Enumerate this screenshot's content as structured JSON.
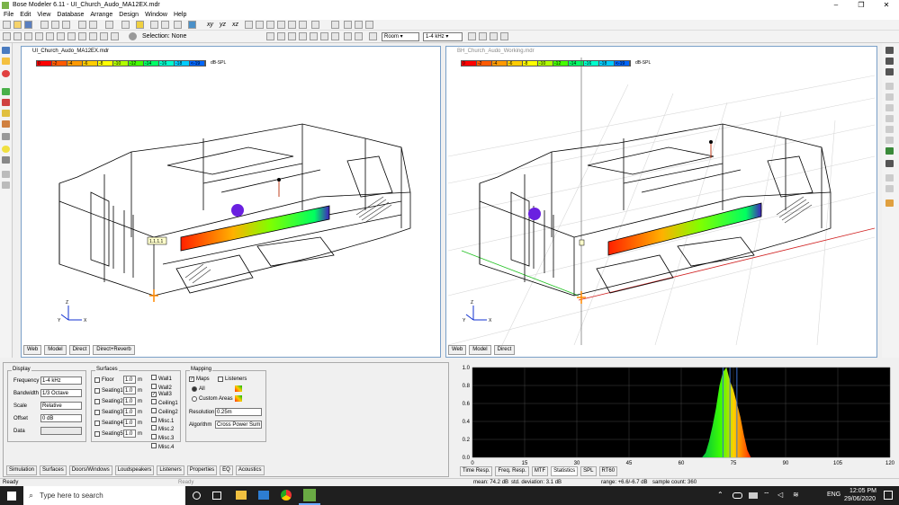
{
  "app": {
    "title": "Bose Modeler 6.11 - UI_Church_Audo_MA12EX.mdr"
  },
  "window_buttons": {
    "minimize": "–",
    "maximize": "❐",
    "close": "✕"
  },
  "menu": [
    "File",
    "Edit",
    "View",
    "Database",
    "Arrange",
    "Design",
    "Window",
    "Help"
  ],
  "toolbar": {
    "xy": "xy",
    "yz": "yz",
    "xz": "xz",
    "selection": "Selection: None",
    "room_select": "Room",
    "freq_select": "1-4 kHz"
  },
  "legend": {
    "labels": [
      "0",
      "-2",
      "-4",
      "-6",
      "-8",
      "-10",
      "-12",
      "-14",
      "-16",
      "-18",
      "<-19"
    ],
    "colors": [
      "#ff0000",
      "#ff5a00",
      "#ff9900",
      "#ffcc00",
      "#ffff00",
      "#b0ff00",
      "#44ff00",
      "#00ff66",
      "#00ffcc",
      "#00ccff",
      "#0066ff"
    ],
    "unit": "dB-SPL"
  },
  "windows": {
    "left": {
      "title": "UI_Church_Audo_MA12EX.mdr",
      "tabs": [
        "Web",
        "Model",
        "Direct",
        "Direct+Reverb"
      ],
      "listener_tag": "1.1.1.1"
    },
    "right": {
      "title": "BH_Church_Audo_Working.mdr",
      "tabs": [
        "Web",
        "Model",
        "Direct"
      ]
    }
  },
  "axes": {
    "y": "Y",
    "z": "Z",
    "x": "X"
  },
  "display": {
    "group": "Display",
    "frequency_label": "Frequency",
    "frequency": "1-4 kHz",
    "bandwidth_label": "Bandwidth",
    "bandwidth": "1/3 Octave",
    "scale_label": "Scale",
    "scale": "Relative",
    "offset_label": "Offset",
    "offset": "0 dB",
    "data_label": "Data",
    "data": ""
  },
  "surfaces": {
    "group": "Surfaces",
    "items": [
      {
        "label": "Floor",
        "value": "1.0",
        "unit": "m"
      },
      {
        "label": "Seating1",
        "value": "1.0",
        "unit": "m"
      },
      {
        "label": "Seating2",
        "value": "1.0",
        "unit": "m"
      },
      {
        "label": "Seating3",
        "value": "1.0",
        "unit": "m"
      },
      {
        "label": "Seating4",
        "value": "1.0",
        "unit": "m"
      },
      {
        "label": "Seating5",
        "value": "1.0",
        "unit": "m"
      }
    ],
    "right_items": [
      "Wall1",
      "Wall2",
      "Wall3",
      "Ceiling1",
      "Ceiling2",
      "Misc.1",
      "Misc.2",
      "Misc.3",
      "Misc.4"
    ]
  },
  "mapping": {
    "group": "Mapping",
    "maps": "Maps",
    "listeners": "Listeners",
    "all": "All",
    "custom": "Custom Areas",
    "resolution_label": "Resolution",
    "resolution": "0.25m",
    "algorithm_label": "Algorithm",
    "algorithm": "Cross Power Sum"
  },
  "panel_tabs": [
    "Simulation",
    "Surfaces",
    "Doors/Windows",
    "Loudspeakers",
    "Listeners",
    "Properties",
    "EQ",
    "Acoustics"
  ],
  "stats_tabs": [
    "Time Resp.",
    "Freq. Resp.",
    "MTF",
    "Statistics",
    "SPL",
    "RT60"
  ],
  "chart_data": {
    "type": "area",
    "x_ticks": [
      "0",
      "15",
      "30",
      "45",
      "60",
      "75",
      "90",
      "105",
      "120"
    ],
    "y_ticks": [
      "0.0",
      "0.2",
      "0.4",
      "0.6",
      "0.8",
      "1.0"
    ],
    "xlim": [
      0,
      120
    ],
    "ylim": [
      0,
      1
    ],
    "x": [
      66,
      67,
      68,
      69,
      70,
      71,
      72,
      73,
      74,
      75,
      76,
      77,
      78,
      79,
      80
    ],
    "values": [
      0,
      0.05,
      0.18,
      0.35,
      0.55,
      0.8,
      0.95,
      1.0,
      0.85,
      0.75,
      0.6,
      0.45,
      0.25,
      0.08,
      0
    ],
    "markers": [
      72,
      74,
      76
    ]
  },
  "statusbar": {
    "left": "Ready",
    "mid": "Ready",
    "mean": "mean: 74.2 dB",
    "std": "std. deviation: 3.1 dB",
    "range": "range: +6.6/-6.7 dB",
    "samples": "sample count: 360"
  },
  "taskbar": {
    "search": "Type here to search",
    "lang": "ENG",
    "time": "12:05 PM",
    "date": "29/06/2020"
  }
}
